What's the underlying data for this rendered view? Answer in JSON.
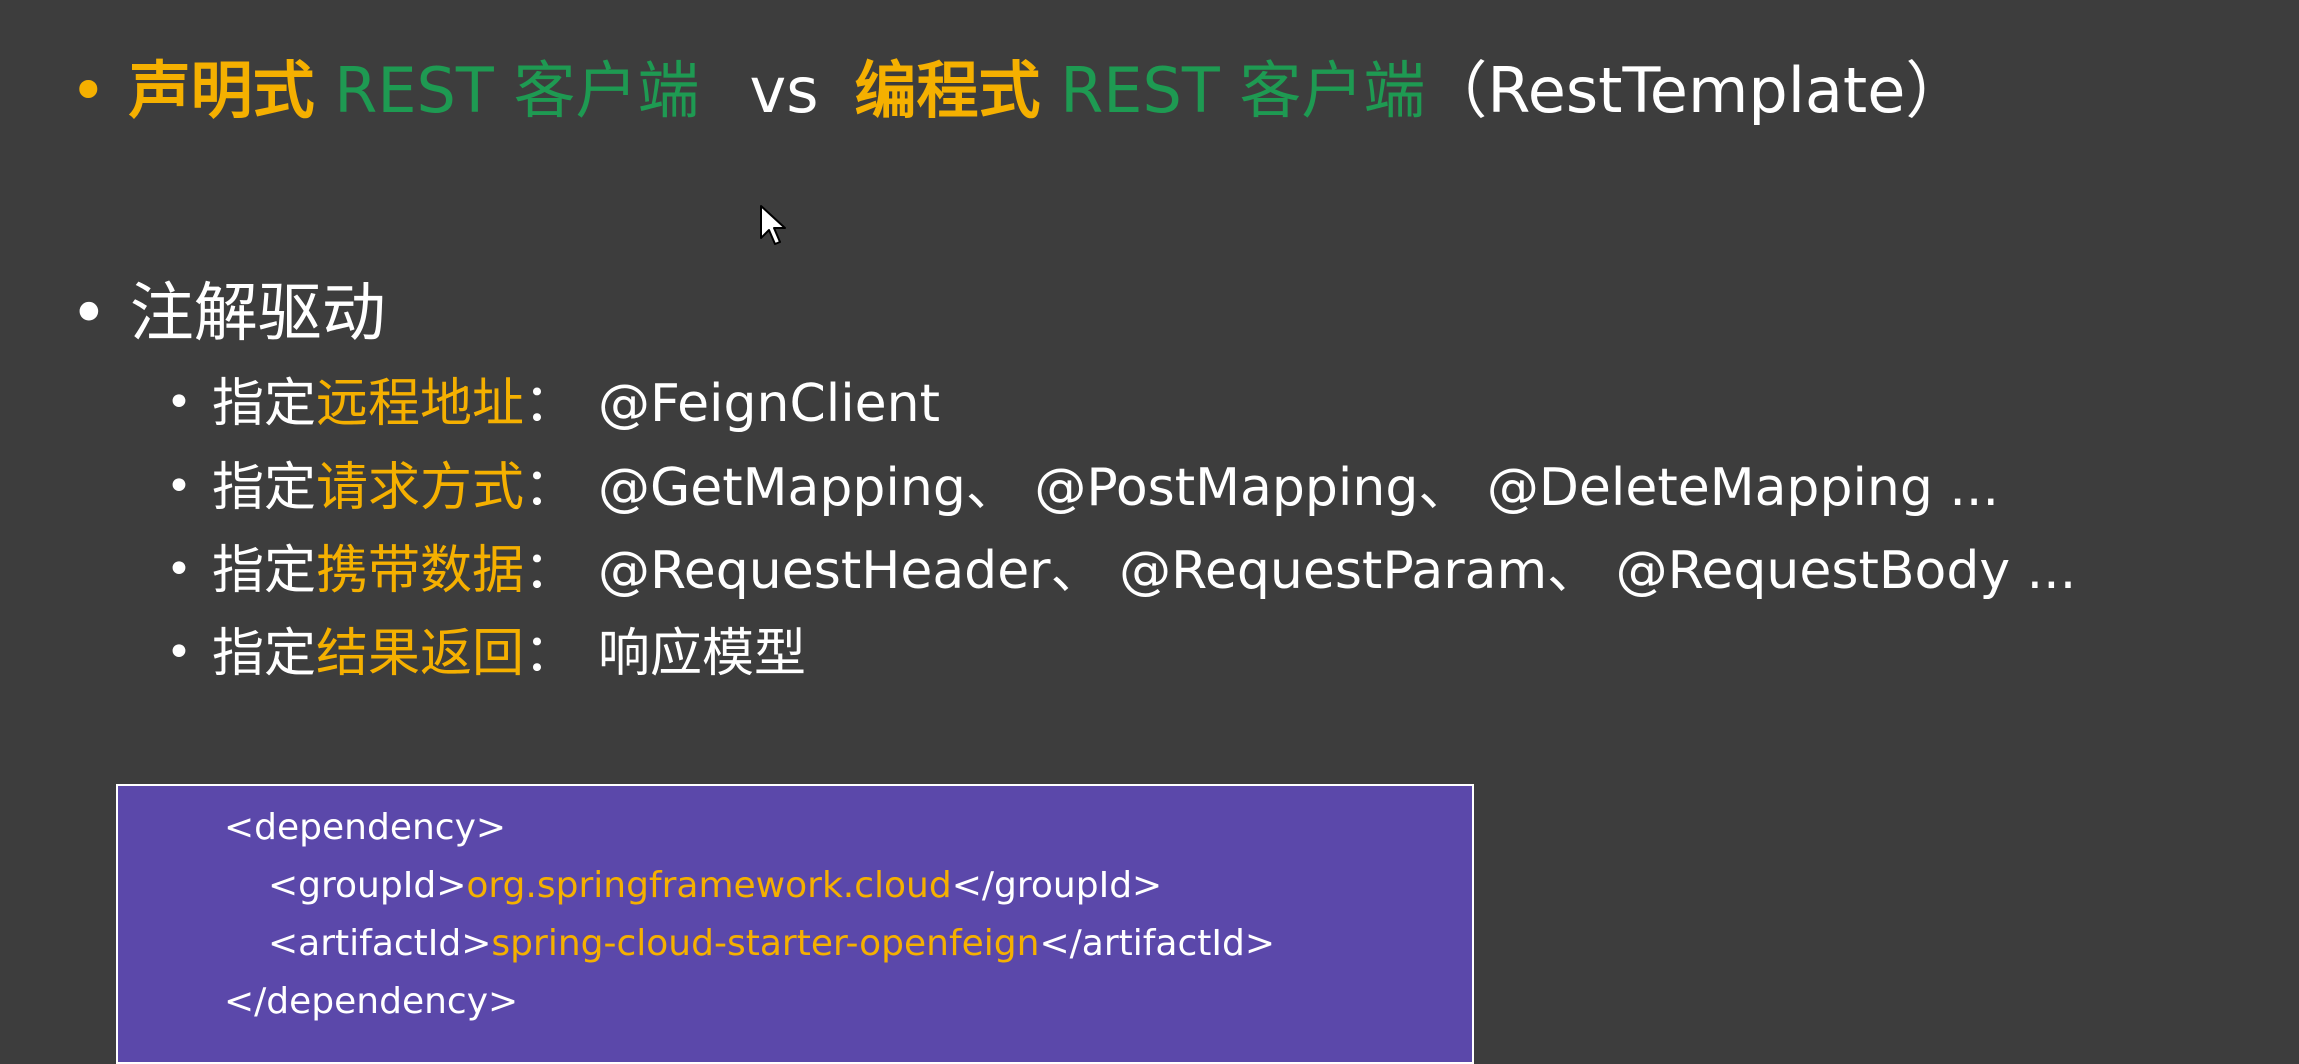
{
  "title": {
    "bullet": "•",
    "part1_strong": "声明式",
    "part1_green": " REST 客户端",
    "vs": "vs",
    "part2_strong": "编程式",
    "part2_green": " REST 客户端",
    "part3": "（RestTemplate）"
  },
  "heading": {
    "bullet": "•",
    "label": "注解驱动"
  },
  "items": [
    {
      "bullet": "•",
      "prefix": "指定",
      "highlight": "远程地址",
      "colon": "：",
      "value": "@FeignClient"
    },
    {
      "bullet": "•",
      "prefix": "指定",
      "highlight": "请求方式",
      "colon": "：",
      "value": "@GetMapping、 @PostMapping、 @DeleteMapping ..."
    },
    {
      "bullet": "•",
      "prefix": "指定",
      "highlight": "携带数据",
      "colon": "：",
      "value": "@RequestHeader、 @RequestParam、 @RequestBody ..."
    },
    {
      "bullet": "•",
      "prefix": "指定",
      "highlight": "结果返回",
      "colon": "：",
      "value": "响应模型"
    }
  ],
  "code": {
    "line1": "<dependency>",
    "line2_open": "<groupId>",
    "line2_value": "org.springframework.cloud",
    "line2_close": "</groupId>",
    "line3_open": "<artifactId>",
    "line3_value": "spring-cloud-starter-openfeign",
    "line3_close": "</artifactId>",
    "line4": "</dependency>"
  },
  "colors": {
    "background": "#3d3d3d",
    "accent_orange": "#f5b000",
    "accent_green": "#1e9a52",
    "code_bg": "#5b48aa"
  },
  "icons": {
    "cursor": "mouse-pointer-icon"
  }
}
